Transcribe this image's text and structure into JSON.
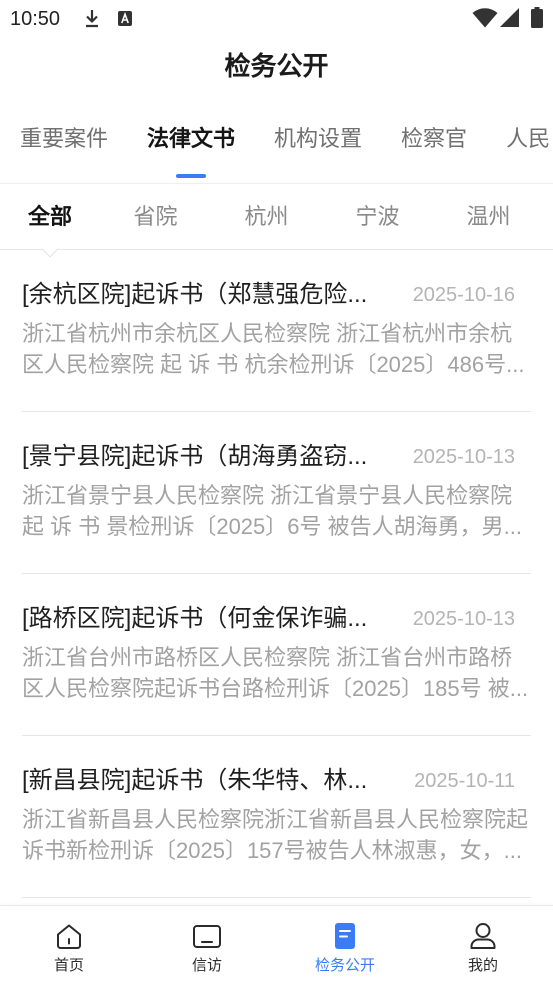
{
  "theme": {
    "accent": "#3b7cf6"
  },
  "status_bar": {
    "time": "10:50",
    "left_icons": [
      "download-icon",
      "a-notification-icon"
    ],
    "right_icons": [
      "wifi-icon",
      "signal-icon",
      "battery-icon"
    ]
  },
  "header": {
    "title": "检务公开"
  },
  "tabs": [
    {
      "label": "重要案件",
      "selected": false
    },
    {
      "label": "法律文书",
      "selected": true
    },
    {
      "label": "机构设置",
      "selected": false
    },
    {
      "label": "检察官",
      "selected": false
    },
    {
      "label": "人民",
      "selected": false
    }
  ],
  "sub_tabs": [
    {
      "label": "全部",
      "selected": true
    },
    {
      "label": "省院",
      "selected": false
    },
    {
      "label": "杭州",
      "selected": false
    },
    {
      "label": "宁波",
      "selected": false
    },
    {
      "label": "温州",
      "selected": false
    }
  ],
  "documents": [
    {
      "title": "[余杭区院]起诉书（郑慧强危险...",
      "date": "2025-10-16",
      "summary": [
        "浙江省杭州市余杭区人民检察院 浙江省杭州市余杭",
        "区人民检察院 起 诉 书 杭余检刑诉〔2025〕486号..."
      ]
    },
    {
      "title": "[景宁县院]起诉书（胡海勇盗窃...",
      "date": "2025-10-13",
      "summary": [
        "浙江省景宁县人民检察院 浙江省景宁县人民检察院",
        "起 诉 书 景检刑诉〔2025〕6号 被告人胡海勇，男..."
      ]
    },
    {
      "title": "[路桥区院]起诉书（何金保诈骗...",
      "date": "2025-10-13",
      "summary": [
        "浙江省台州市路桥区人民检察院 浙江省台州市路桥",
        "区人民检察院起诉书台路检刑诉〔2025〕185号 被..."
      ]
    },
    {
      "title": "[新昌县院]起诉书（朱华特、林...",
      "date": "2025-10-11",
      "summary": [
        "浙江省新昌县人民检察院浙江省新昌县人民检察院起",
        "诉书新检刑诉〔2025〕157号被告人林淑惠，女，..."
      ]
    }
  ],
  "bottom_nav": [
    {
      "label": "首页",
      "icon": "home-icon",
      "active": false
    },
    {
      "label": "信访",
      "icon": "petition-icon",
      "active": false
    },
    {
      "label": "检务公开",
      "icon": "document-icon",
      "active": true
    },
    {
      "label": "我的",
      "icon": "user-icon",
      "active": false
    }
  ]
}
